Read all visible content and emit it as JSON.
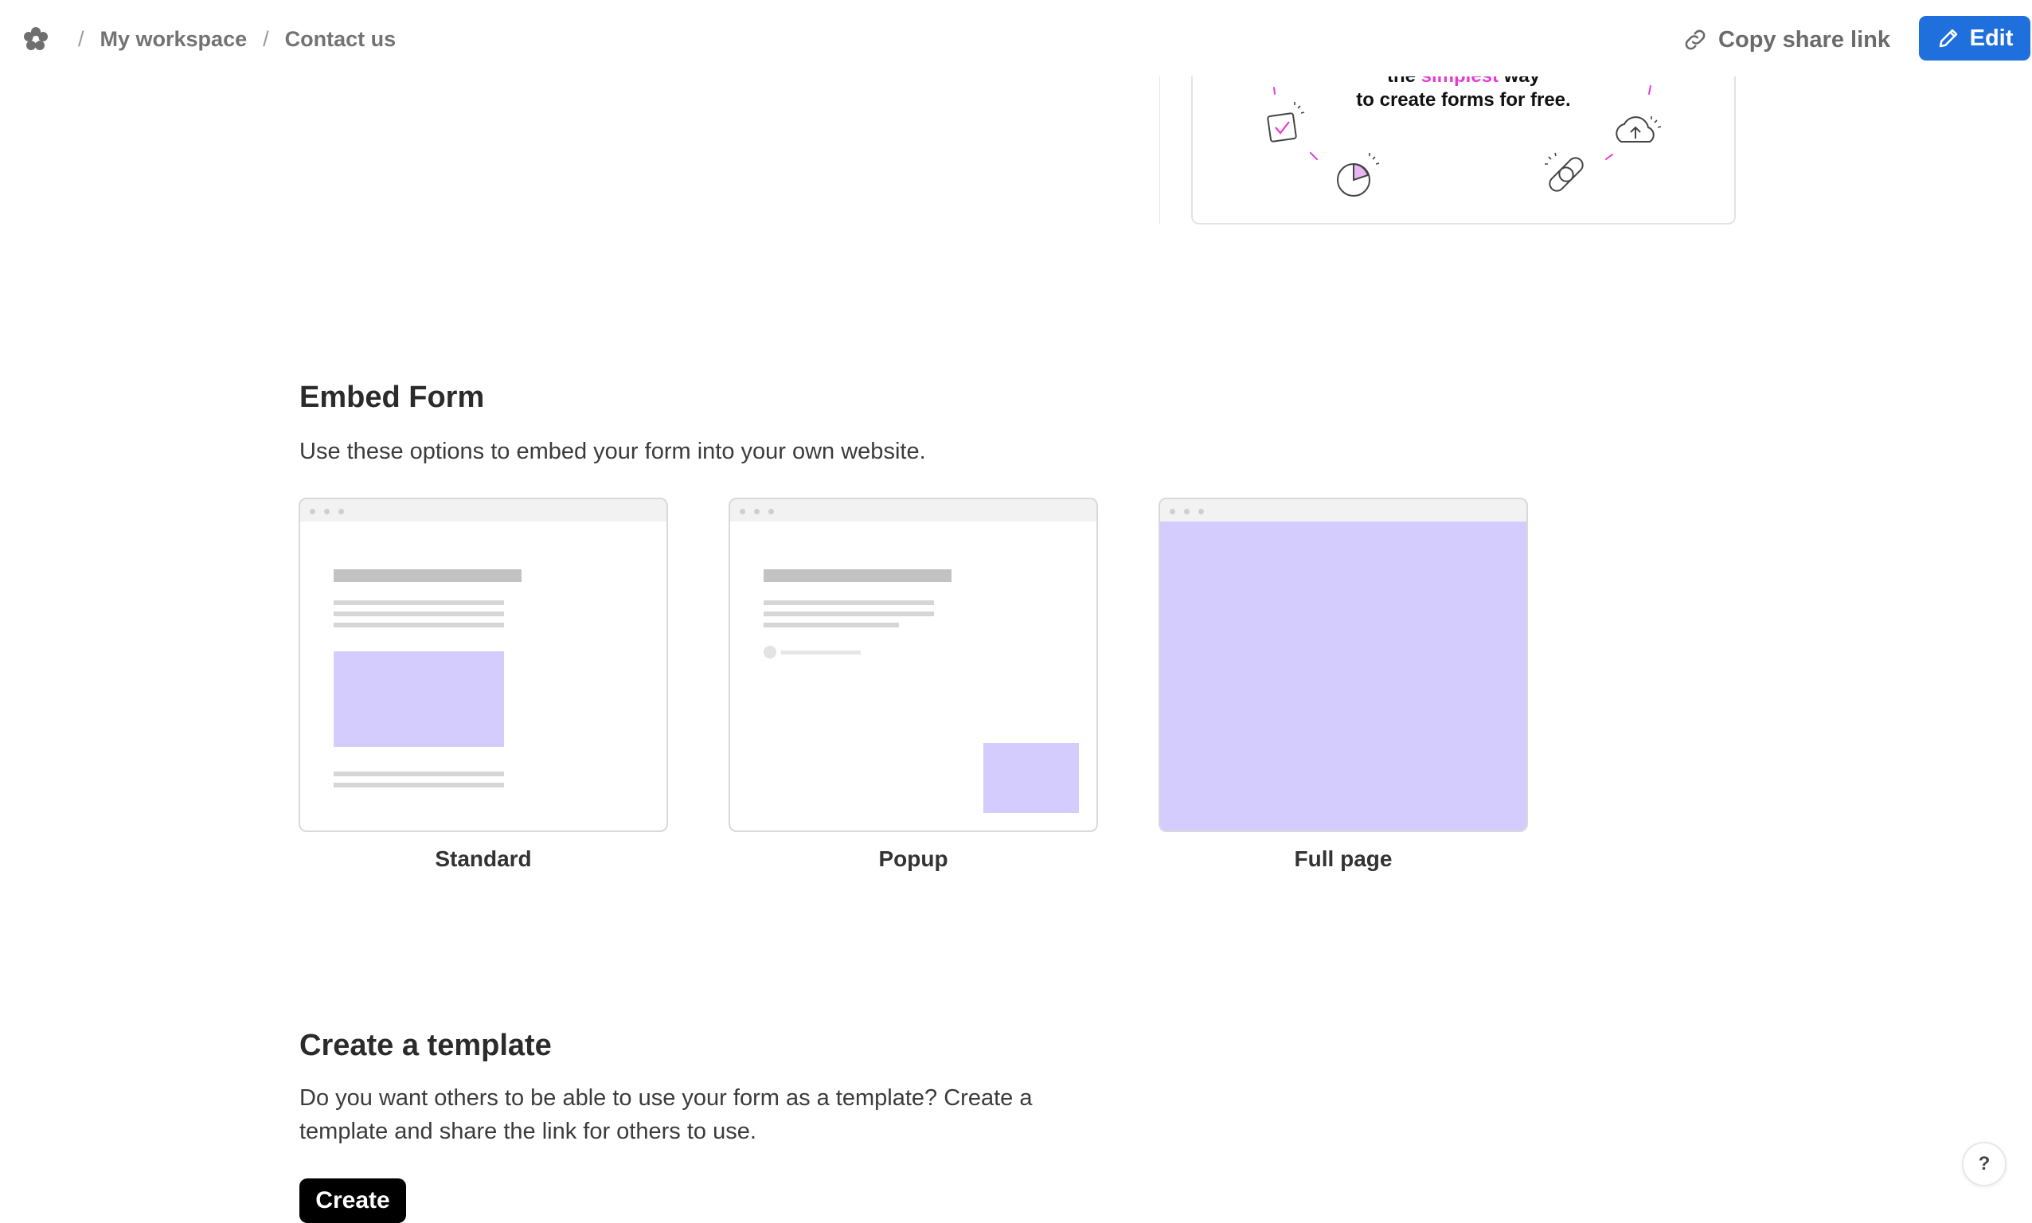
{
  "breadcrumb": {
    "items": [
      "My workspace",
      "Contact us"
    ],
    "separator": "/"
  },
  "header": {
    "copy_link_label": "Copy share link",
    "edit_label": "Edit"
  },
  "preview": {
    "line1_pre": "the",
    "line1_highlight": "simplest",
    "line1_post": "way",
    "line2": "to create forms for free."
  },
  "embed": {
    "title": "Embed Form",
    "description": "Use these options to embed your form into your own website.",
    "options": [
      {
        "label": "Standard"
      },
      {
        "label": "Popup"
      },
      {
        "label": "Full page"
      }
    ]
  },
  "template": {
    "title": "Create a template",
    "description_line1": "Do you want others to be able to use your form as a template? Create a",
    "description_line2": "template and share the link for others to use.",
    "button_label": "Create"
  },
  "help": {
    "label": "?"
  },
  "colors": {
    "accent": "#1f6fdc",
    "lavender": "#d3ccfc",
    "highlight": "#e63ad8"
  },
  "icons": {
    "logo": "flower-logo-icon",
    "link": "link-icon",
    "edit": "pencil-icon"
  }
}
